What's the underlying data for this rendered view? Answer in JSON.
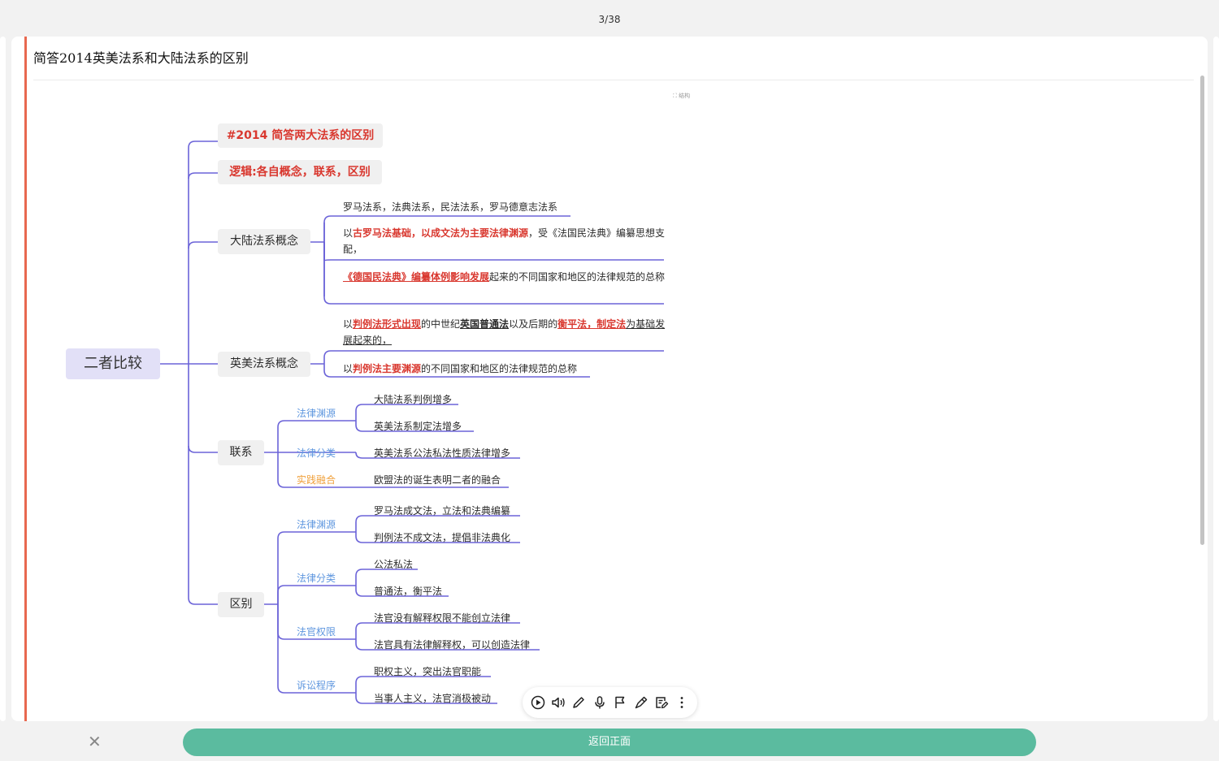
{
  "pager": "3/38",
  "card": {
    "title": "简答2014英美法系和大陆法系的区别"
  },
  "layout_tag": "⛶ 结构",
  "mindmap": {
    "root": "二者比较",
    "b1": "#2014 简答两大法系的区别",
    "b2": "逻辑:各自概念，联系，区别",
    "continental": {
      "label": "大陆法系概念",
      "l1": "罗马法系，法典法系，民法法系，罗马德意志法系",
      "l2_a": "以",
      "l2_b": "古罗马法基础，以成文法为主要法律渊源",
      "l2_c": "，受《法国民法典》编纂思想支配，",
      "l3_a": "《德国民法典》编纂体例影响发展",
      "l3_b": "起来的不同国家和地区的法律规范的总称"
    },
    "common": {
      "label": "英美法系概念",
      "l1_a": "以",
      "l1_b": "判例法形式出现",
      "l1_c": "的中世纪",
      "l1_d": "英国普通法",
      "l1_e": "以及后期的",
      "l1_f": "衡平法，制定法",
      "l1_g": "为基础发展起来的，",
      "l2_a": "以",
      "l2_b": "判例法主要渊源",
      "l2_c": "的不同国家和地区的法律规范的总称"
    },
    "relation": {
      "label": "联系",
      "c1": "法律渊源",
      "c1_l1": "大陆法系判例增多",
      "c1_l2": "英美法系制定法增多",
      "c2": "法律分类",
      "c2_l1": "英美法系公法私法性质法律增多",
      "c3": "实践融合",
      "c3_l1": "欧盟法的诞生表明二者的融合"
    },
    "difference": {
      "label": "区别",
      "d1": "法律渊源",
      "d1_l1": "罗马法成文法，立法和法典编纂",
      "d1_l2": "判例法不成文法，提倡非法典化",
      "d2": "法律分类",
      "d2_l1": "公法私法",
      "d2_l2": "普通法，衡平法",
      "d3": "法官权限",
      "d3_l1": "法官没有解释权限不能创立法律",
      "d3_l2": "法官具有法律解释权，可以创造法律",
      "d4": "诉讼程序",
      "d4_l1": "职权主义，突出法官职能",
      "d4_l2": "当事人主义，法官消极被动"
    }
  },
  "toolbar": {
    "icons": [
      "play-icon",
      "speaker-icon",
      "pencil-icon",
      "microphone-icon",
      "flag-icon",
      "pen-icon",
      "edit-note-icon",
      "more-icon"
    ]
  },
  "footer": {
    "close": "✕",
    "back_label": "返回正面"
  },
  "colors": {
    "accent": "#e8684f",
    "branch": "#6b63d8",
    "button": "#5bbb9f",
    "red_text": "#d9382f",
    "blue_text": "#5f97df",
    "orange_text": "#f0a03a"
  }
}
